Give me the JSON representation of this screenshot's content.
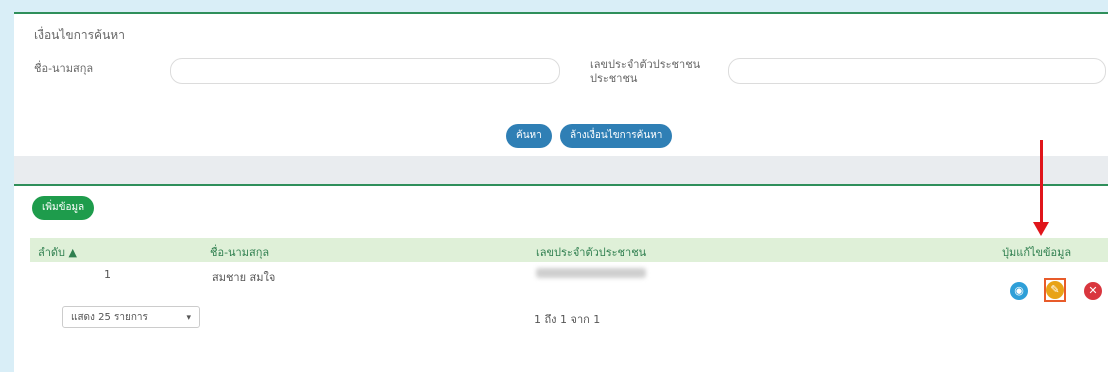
{
  "search": {
    "title": "เงื่อนไขการค้นหา",
    "name_label": "ชื่อ-นามสกุล",
    "name_value": "",
    "id_label_line1": "เลขประจำตัวประชาชน",
    "id_label_line2": "ประชาชน",
    "id_value": "",
    "search_button": "ค้นหา",
    "clear_button": "ล้างเงื่อนไขการค้นหา"
  },
  "toolbar": {
    "add_button": "เพิ่มข้อมูล"
  },
  "table": {
    "columns": [
      "ลำดับ ▲",
      "ชื่อ-นามสกุล",
      "เลขประจำตัวประชาชน",
      "ปุ่มแก้ไขข้อมูล"
    ],
    "rows": [
      {
        "index": "1",
        "name": "สมชาย สมใจ",
        "id": ""
      }
    ],
    "actions": [
      {
        "icon": "view-icon",
        "color": "#2e9fd8"
      },
      {
        "icon": "edit-icon",
        "color": "#e8a317"
      },
      {
        "icon": "delete-icon",
        "color": "#d9363e"
      }
    ]
  },
  "pagination": {
    "page_size": "แสดง 25 รายการ",
    "page_info": "1 ถึง 1 จาก 1"
  },
  "colors": {
    "accent_green": "#2f8f5b",
    "button_blue": "#2f7fb5",
    "button_green": "#1e9c4c",
    "annotation_red": "#e0151b"
  }
}
